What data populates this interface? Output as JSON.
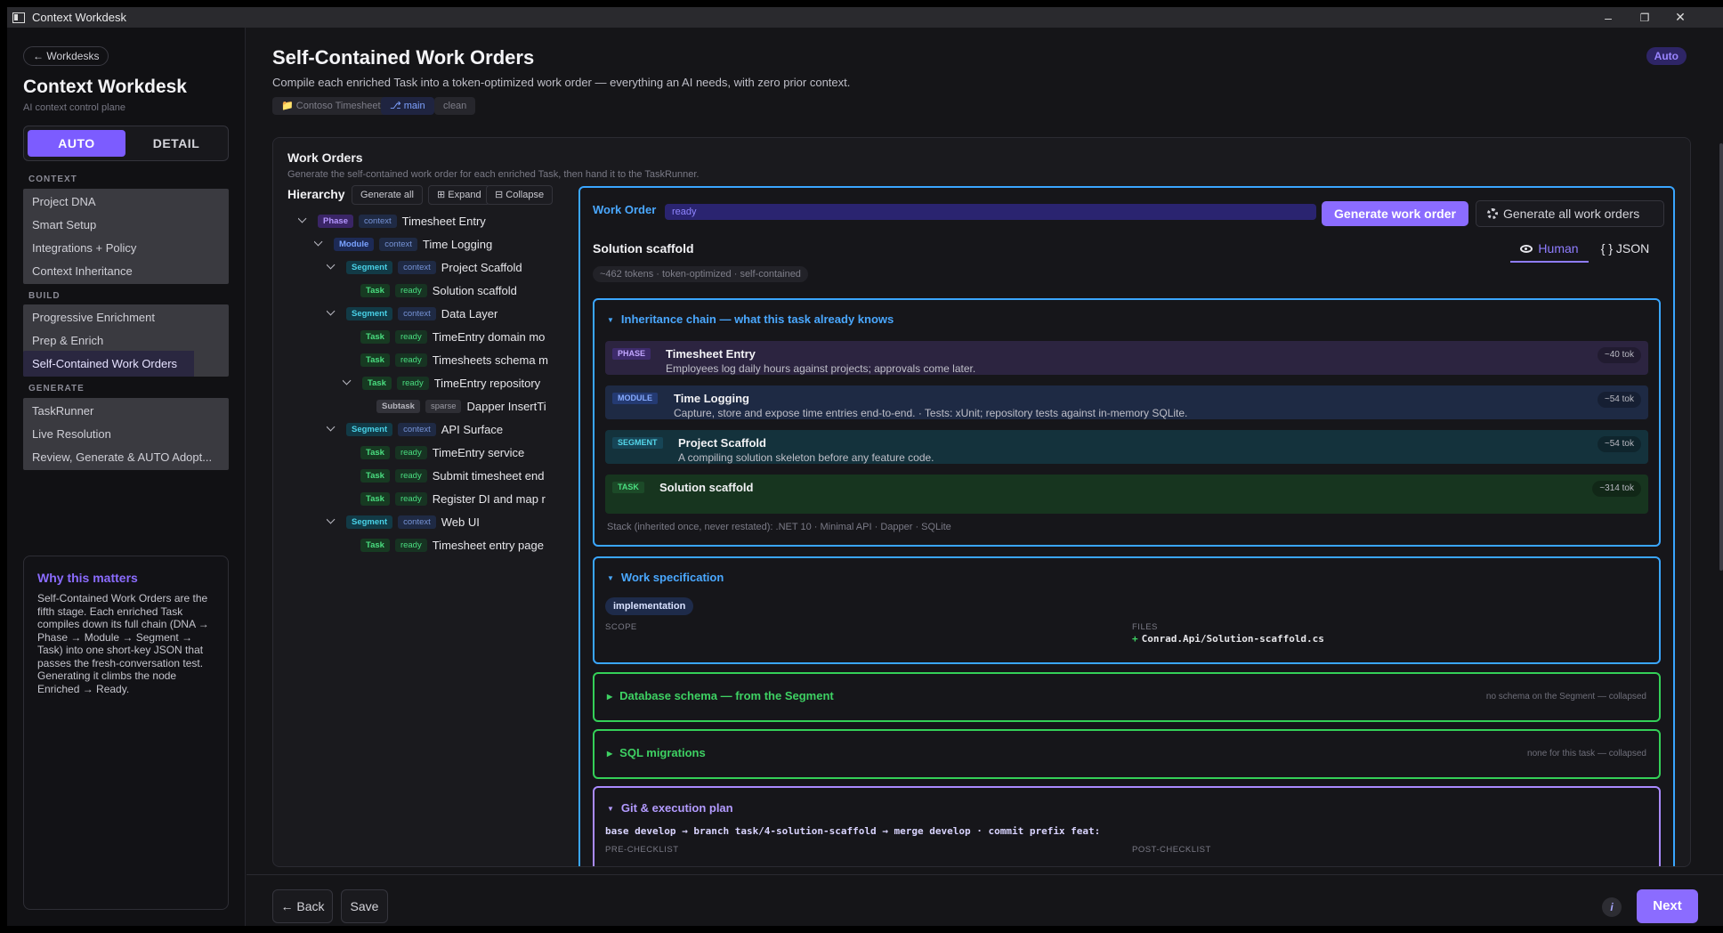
{
  "window": {
    "title": "Context Workdesk",
    "min": "–",
    "restore": "❐",
    "close": "✕"
  },
  "sidebar": {
    "back": "← Workdesks",
    "brand": "Context Workdesk",
    "brand_sub": "AI context control plane",
    "modes": [
      "AUTO",
      "DETAIL"
    ],
    "sections": [
      {
        "label": "CONTEXT",
        "items": [
          "Project DNA",
          "Smart Setup",
          "Integrations + Policy",
          "Context Inheritance"
        ]
      },
      {
        "label": "BUILD",
        "items": [
          "Progressive Enrichment",
          "Prep & Enrich",
          "Self-Contained Work Orders"
        ]
      },
      {
        "label": "GENERATE",
        "items": [
          "TaskRunner",
          "Live Resolution",
          "Review, Generate & AUTO Adopt..."
        ]
      }
    ],
    "why_title": "Why this matters",
    "why_body": "Self-Contained Work Orders are the fifth stage. Each enriched Task compiles down its full chain (DNA → Phase → Module → Segment → Task) into one short-key JSON that passes the fresh-conversation test. Generating it climbs the node Enriched → Ready."
  },
  "header": {
    "title": "Self-Contained Work Orders",
    "desc": "Compile each enriched Task into a token-optimized work order — everything an AI needs, with zero prior context.",
    "chips": [
      "📁 Contoso Timesheet",
      "⎇ main",
      "clean"
    ],
    "mode_badge": "Auto"
  },
  "panel": {
    "title": "Work Orders",
    "sub": "Generate the self-contained work order for each enriched Task, then hand it to the TaskRunner.",
    "hierarchy_label": "Hierarchy",
    "buttons": [
      "Generate all",
      "⊞ Expand",
      "⊟ Collapse"
    ],
    "tree": [
      {
        "type": "Phase",
        "status": "context",
        "label": "Timesheet Entry"
      },
      {
        "type": "Module",
        "status": "context",
        "label": "Time Logging"
      },
      {
        "type": "Segment",
        "status": "context",
        "label": "Project Scaffold"
      },
      {
        "type": "Task",
        "status": "ready",
        "label": "Solution scaffold"
      },
      {
        "type": "Segment",
        "status": "context",
        "label": "Data Layer"
      },
      {
        "type": "Task",
        "status": "ready",
        "label": "TimeEntry domain mo"
      },
      {
        "type": "Task",
        "status": "ready",
        "label": "Timesheets schema m"
      },
      {
        "type": "Task",
        "status": "ready",
        "label": "TimeEntry repository"
      },
      {
        "type": "Subtask",
        "status": "sparse",
        "label": "Dapper InsertTi"
      },
      {
        "type": "Segment",
        "status": "context",
        "label": "API Surface"
      },
      {
        "type": "Task",
        "status": "ready",
        "label": "TimeEntry service"
      },
      {
        "type": "Task",
        "status": "ready",
        "label": "Submit timesheet end"
      },
      {
        "type": "Task",
        "status": "ready",
        "label": "Register DI and map r"
      },
      {
        "type": "Segment",
        "status": "context",
        "label": "Web UI"
      },
      {
        "type": "Task",
        "status": "ready",
        "label": "Timesheet entry page"
      }
    ]
  },
  "work_order": {
    "label": "Work Order",
    "status": "ready",
    "generate_btn": "Generate work order",
    "generate_all_btn": "Generate all work orders",
    "title": "Solution scaffold",
    "views": [
      "Human",
      "{ } JSON"
    ],
    "tokens": "~462 tokens · token-optimized · self-contained",
    "inheritance": {
      "title": "Inheritance chain — what this task already knows",
      "rows": [
        {
          "tag": "PHASE",
          "name": "Timesheet Entry",
          "desc": "Employees log daily hours against projects; approvals come later.",
          "tok": "~40 tok"
        },
        {
          "tag": "MODULE",
          "name": "Time Logging",
          "desc": "Capture, store and expose time entries end-to-end. · Tests: xUnit; repository tests against in-memory SQLite.",
          "tok": "~54 tok"
        },
        {
          "tag": "SEGMENT",
          "name": "Project Scaffold",
          "desc": "A compiling solution skeleton before any feature code.",
          "tok": "~54 tok"
        },
        {
          "tag": "TASK",
          "name": "Solution scaffold",
          "desc": "",
          "tok": "~314 tok"
        }
      ],
      "stack": "Stack (inherited once, never restated): .NET 10 · Minimal API · Dapper · SQLite"
    },
    "spec": {
      "title": "Work specification",
      "chip": "implementation",
      "scope_label": "SCOPE",
      "files_label": "FILES",
      "file": "Conrad.Api/Solution-scaffold.cs"
    },
    "db": {
      "title": "Database schema — from the Segment",
      "note": "no schema on the Segment — collapsed"
    },
    "sql": {
      "title": "SQL migrations",
      "note": "none for this task — collapsed"
    },
    "git": {
      "title": "Git & execution plan",
      "line": "base develop → branch task/4-solution-scaffold → merge develop  ·  commit prefix feat:",
      "pre": "PRE-CHECKLIST",
      "post": "POST-CHECKLIST"
    }
  },
  "footer": {
    "back": "← Back",
    "save": "Save",
    "info": "i",
    "next": "Next"
  },
  "colors": {
    "accent": "#8b6cff",
    "blue": "#3aa6ff",
    "green": "#34d058"
  }
}
